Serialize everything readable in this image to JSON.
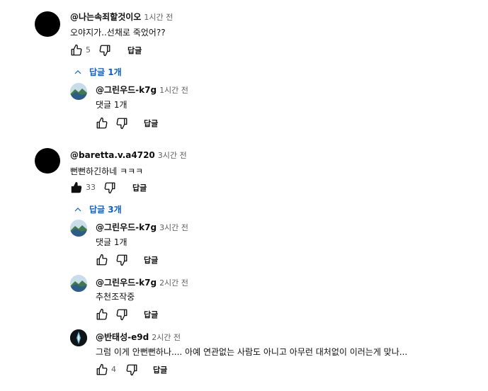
{
  "threads": [
    {
      "author": "@나는속죄할것이오",
      "time": "1시간 전",
      "text": "오야지가..선채로 죽었어??",
      "likes": "5",
      "reply_label": "답글",
      "replies_toggle": "답글 1개",
      "replies": [
        {
          "author": "@그린우드-k7g",
          "time": "1시간 전",
          "text": "댓글 1개",
          "likes": "",
          "reply_label": "답글"
        }
      ]
    },
    {
      "author": "@baretta.v.a4720",
      "time": "3시간 전",
      "text": "뻔뻔하긴하네 ㅋㅋㅋ",
      "likes": "33",
      "reply_label": "답글",
      "replies_toggle": "답글 3개",
      "replies": [
        {
          "author": "@그린우드-k7g",
          "time": "3시간 전",
          "text": "댓글 1개",
          "likes": "",
          "reply_label": "답글"
        },
        {
          "author": "@그린우드-k7g",
          "time": "2시간 전",
          "text": "추천조작중",
          "likes": "",
          "reply_label": "답글"
        },
        {
          "author": "@반태성-e9d",
          "time": "2시간 전",
          "text": "그럼 이게 안뻔뻔하나.... 아예 연관없는 사람도 아니고 아무런 대처없이 이러는게 맞나...",
          "likes": "4",
          "reply_label": "답글"
        }
      ]
    }
  ],
  "icons": {
    "like": "thumbs-up-icon",
    "dislike": "thumbs-down-icon",
    "collapse": "chevron-up-icon"
  },
  "colors": {
    "link": "#065fd4",
    "secondary_text": "#606060",
    "liked_icon": "#0f0f0f"
  }
}
